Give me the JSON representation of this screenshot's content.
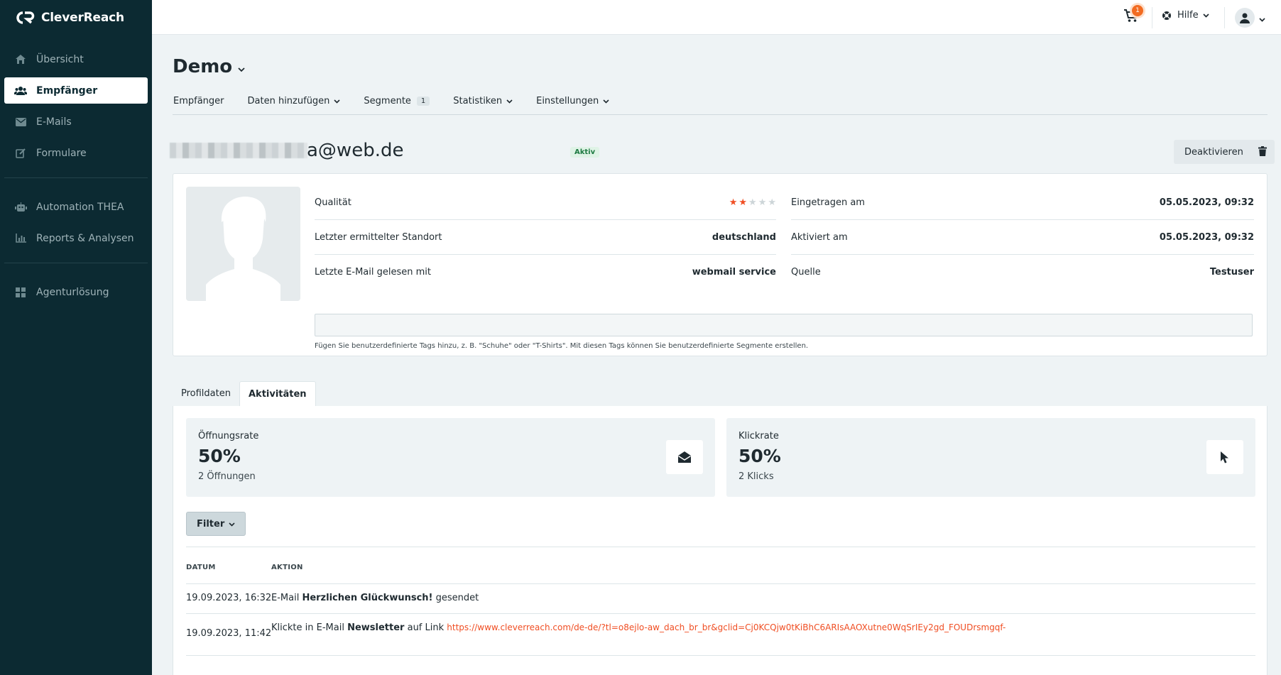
{
  "app": {
    "brand": "CleverReach"
  },
  "sidebar": {
    "items": [
      {
        "label": "Übersicht",
        "icon": "home-icon"
      },
      {
        "label": "Empfänger",
        "icon": "users-icon",
        "active": true
      },
      {
        "label": "E-Mails",
        "icon": "envelope-icon"
      },
      {
        "label": "Formulare",
        "icon": "edit-form-icon"
      },
      {
        "label": "Automation THEA",
        "icon": "robot-icon"
      },
      {
        "label": "Reports & Analysen",
        "icon": "bar-chart-icon"
      },
      {
        "label": "Agenturlösung",
        "icon": "grid-icon"
      }
    ]
  },
  "topbar": {
    "cart_count": "1",
    "help_label": "Hilfe"
  },
  "page": {
    "title": "Demo",
    "subnav": [
      {
        "label": "Empfänger"
      },
      {
        "label": "Daten hinzufügen",
        "dropdown": true
      },
      {
        "label": "Segmente",
        "badge": "1"
      },
      {
        "label": "Statistiken",
        "dropdown": true
      },
      {
        "label": "Einstellungen",
        "dropdown": true
      }
    ]
  },
  "contact": {
    "email_visible": "a@web.de",
    "status": "Aktiv",
    "deactivate_label": "Deaktivieren"
  },
  "profile": {
    "left": [
      {
        "label": "Qualität",
        "rating": 2,
        "rating_max": 5
      },
      {
        "label": "Letzter ermittelter Standort",
        "value": "deutschland"
      },
      {
        "label": "Letzte E-Mail gelesen mit",
        "value": "webmail service"
      }
    ],
    "right": [
      {
        "label": "Eingetragen am",
        "value": "05.05.2023, 09:32"
      },
      {
        "label": "Aktiviert am",
        "value": "05.05.2023, 09:32"
      },
      {
        "label": "Quelle",
        "value": "Testuser"
      }
    ],
    "tags_value": "",
    "tags_hint": "Fügen Sie benutzerdefinierte Tags hinzu, z. B. \"Schuhe\" oder \"T-Shirts\". Mit diesen Tags können Sie benutzerdefinierte Segmente erstellen."
  },
  "tabs": [
    {
      "label": "Profildaten"
    },
    {
      "label": "Aktivitäten",
      "active": true
    }
  ],
  "stats": [
    {
      "label": "Öffnungsrate",
      "value": "50%",
      "sub": "2 Öffnungen",
      "icon": "envelope-open-icon"
    },
    {
      "label": "Klickrate",
      "value": "50%",
      "sub": "2 Klicks",
      "icon": "cursor-icon"
    }
  ],
  "filter_label": "Filter",
  "table": {
    "headers": {
      "date": "DATUM",
      "action": "AKTION"
    },
    "rows": [
      {
        "date": "19.09.2023, 16:32",
        "pre": "E-Mail ",
        "bold": "Herzlichen Glückwunsch!",
        "post": " gesendet",
        "mid": "",
        "link": ""
      },
      {
        "date": "19.09.2023, 11:42",
        "pre": "Klickte in E-Mail ",
        "bold": "Newsletter",
        "post": "",
        "mid": " auf Link ",
        "link": "https://www.cleverreach.com/de-de/?tl=o8ejlo-aw_dach_br_br&gclid=Cj0KCQjw0tKiBhC6ARIsAAOXutne0WqSrIEy2gd_FOUDrsmgqf-"
      }
    ]
  },
  "colors": {
    "sidebar_bg": "#0c2a32",
    "accent": "#f04e23",
    "badge_active_bg": "#dff3e6"
  }
}
